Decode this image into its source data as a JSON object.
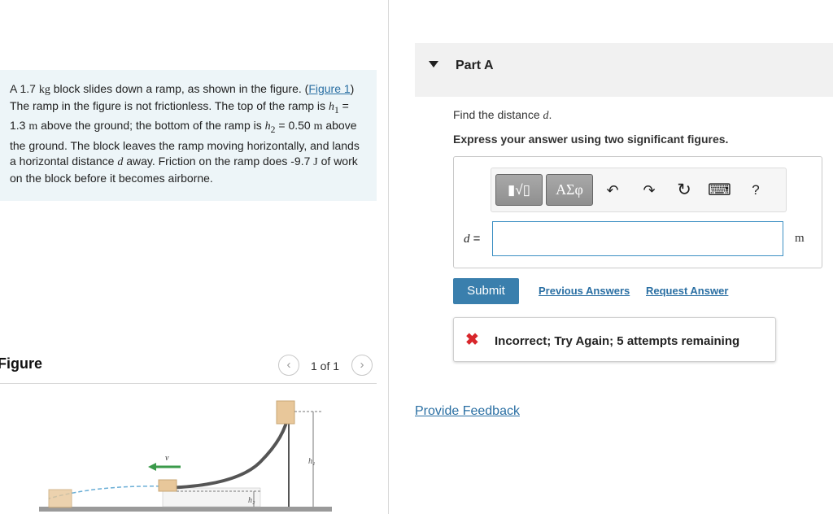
{
  "problem": {
    "prefix": "A 1.7 ",
    "mass_unit": "kg",
    "after_mass": " block slides down a ramp, as shown in the figure. (",
    "figure_link": "Figure 1",
    "after_link": ") The ramp in the figure is not frictionless. The top of the ramp is ",
    "h1_symbol": "h",
    "h1_sub": "1",
    "h1_value": " = 1.3 ",
    "h1_unit": "m",
    "after_h1": " above the ground; the bottom of the ramp is ",
    "h2_symbol": "h",
    "h2_sub": "2",
    "h2_value": " = 0.50 ",
    "h2_unit": "m",
    "after_h2": " above the ground. The block leaves the ramp moving horizontally, and lands a horizontal distance ",
    "d_symbol": "d",
    "after_d": " away. Friction on the ramp does -9.7 ",
    "work_unit": "J",
    "after_work": " of work on the block before it becomes airborne."
  },
  "figure": {
    "title": "Figure",
    "pager_text": "1 of 1",
    "prev_icon": "chevron-left-icon",
    "next_icon": "chevron-right-icon",
    "labels": {
      "h1": "h₁",
      "h2": "h₂",
      "v": "v⃗"
    },
    "colors": {
      "ramp": "#555555",
      "block": "#e8c79a",
      "arrow": "#3a9a4a",
      "trajectory": "#6aaed6"
    }
  },
  "part": {
    "title": "Part A",
    "question_prefix": "Find the distance ",
    "question_var": "d",
    "question_suffix": ".",
    "instruction": "Express your answer using two significant figures."
  },
  "toolbar": {
    "template_label": "▮√▯",
    "greek_label": "ΑΣφ",
    "undo_icon": "↶",
    "redo_icon": "↷",
    "reset_icon": "↻",
    "keyboard_icon": "⌨",
    "help_label": "?"
  },
  "answer": {
    "variable": "d",
    "equals": " =",
    "value": "",
    "unit": "m"
  },
  "actions": {
    "submit": "Submit",
    "previous_answers": "Previous Answers",
    "request_answer": "Request Answer"
  },
  "feedback": {
    "icon": "✖",
    "message": "Incorrect; Try Again; 5 attempts remaining",
    "color": "#d8262b"
  },
  "provide_feedback": "Provide Feedback",
  "colors": {
    "accent": "#3a7fad",
    "link": "#2a6fa3",
    "problem_bg": "#edf5f8"
  }
}
